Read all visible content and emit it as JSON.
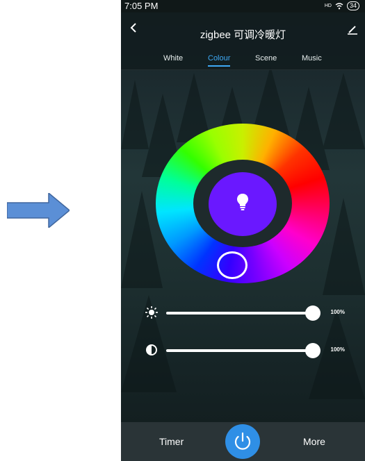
{
  "status_bar": {
    "time": "7:05 PM",
    "signal": "HD",
    "battery": "34"
  },
  "header": {
    "back_icon": "chevron-left-icon",
    "title": "zigbee 可调冷暖灯",
    "edit_icon": "pencil-icon"
  },
  "tabs": [
    {
      "label": "White",
      "active": false
    },
    {
      "label": "Colour",
      "active": true
    },
    {
      "label": "Scene",
      "active": false
    },
    {
      "label": "Music",
      "active": false
    }
  ],
  "color_wheel": {
    "selected_color": "#6a18ff",
    "center_icon": "lightbulb-icon"
  },
  "sliders": [
    {
      "name": "brightness",
      "icon": "sun-icon",
      "percent": "100%",
      "level": 1.0
    },
    {
      "name": "contrast",
      "icon": "contrast-icon",
      "percent": "100%",
      "level": 1.0
    }
  ],
  "bottom_bar": {
    "timer_label": "Timer",
    "power_icon": "power-icon",
    "more_label": "More"
  },
  "colors": {
    "accent": "#3fa9f5",
    "power_button": "#2f8fe6",
    "bottom_bar": "#2a3437"
  },
  "decorations": {
    "arrow_icon": "right-arrow-icon",
    "arrow_color": "#5b8fd6"
  }
}
